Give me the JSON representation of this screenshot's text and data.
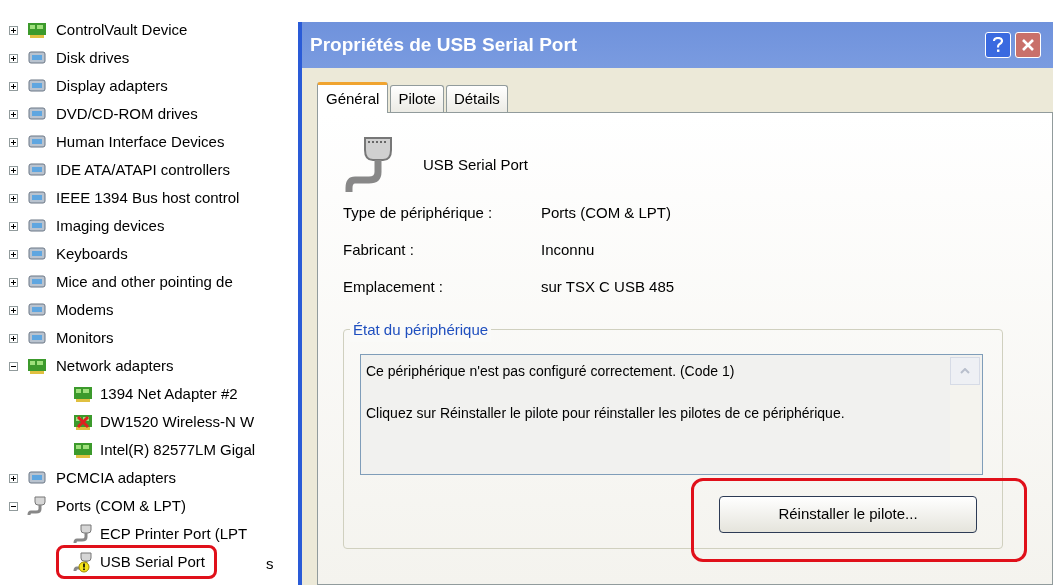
{
  "device_tree": {
    "items": [
      {
        "label": "ControlVault Device",
        "expanded": false
      },
      {
        "label": "Disk drives",
        "expanded": false
      },
      {
        "label": "Display adapters",
        "expanded": false
      },
      {
        "label": "DVD/CD-ROM drives",
        "expanded": false
      },
      {
        "label": "Human Interface Devices",
        "expanded": false
      },
      {
        "label": "IDE ATA/ATAPI controllers",
        "expanded": false
      },
      {
        "label": "IEEE 1394 Bus host control",
        "expanded": false
      },
      {
        "label": "Imaging devices",
        "expanded": false
      },
      {
        "label": "Keyboards",
        "expanded": false
      },
      {
        "label": "Mice and other pointing de",
        "expanded": false
      },
      {
        "label": "Modems",
        "expanded": false
      },
      {
        "label": "Monitors",
        "expanded": false
      },
      {
        "label": "Network adapters",
        "expanded": true,
        "children": [
          {
            "label": "1394 Net Adapter #2",
            "disabled": false,
            "warning": false,
            "highlighted": false
          },
          {
            "label": "DW1520 Wireless-N W",
            "disabled": true,
            "warning": false,
            "highlighted": false
          },
          {
            "label": "Intel(R) 82577LM Gigal",
            "disabled": false,
            "warning": false,
            "highlighted": false
          }
        ]
      },
      {
        "label": "PCMCIA adapters",
        "expanded": false
      },
      {
        "label": "Ports (COM & LPT)",
        "expanded": true,
        "children": [
          {
            "label": "ECP Printer Port (LPT",
            "disabled": false,
            "warning": false,
            "highlighted": false
          },
          {
            "label": "USB Serial Port",
            "disabled": false,
            "warning": true,
            "highlighted": true
          }
        ]
      }
    ],
    "background_fragment": "s"
  },
  "dialog": {
    "title": "Propriétés de USB Serial Port",
    "tabs": [
      {
        "label": "Général",
        "selected": true
      },
      {
        "label": "Pilote",
        "selected": false
      },
      {
        "label": "Détails",
        "selected": false
      }
    ],
    "device_name": "USB Serial Port",
    "properties": [
      {
        "label": "Type de périphérique :",
        "value": "Ports (COM & LPT)"
      },
      {
        "label": "Fabricant :",
        "value": "Inconnu"
      },
      {
        "label": "Emplacement :",
        "value": "sur TSX C USB 485"
      }
    ],
    "status_group": {
      "title": "État du périphérique",
      "lines": [
        "Ce périphérique n'est pas configuré correctement. (Code 1)",
        "Cliquez sur Réinstaller le pilote pour réinstaller les pilotes de ce périphérique."
      ]
    },
    "button": {
      "label": "Réinstaller le pilote...",
      "highlighted": true
    }
  }
}
